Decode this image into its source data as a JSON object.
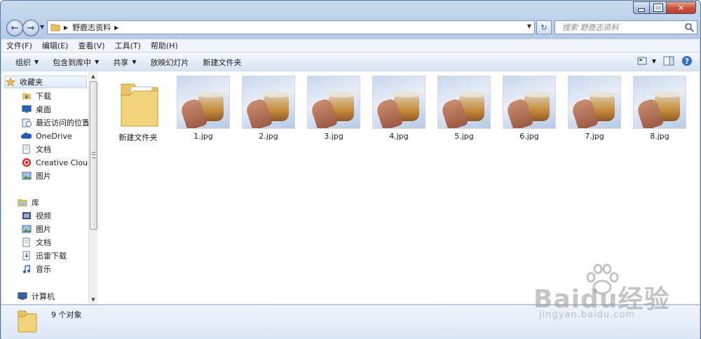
{
  "window": {
    "title_buttons": {
      "minimize": "minimize",
      "maximize": "maximize",
      "close": "close"
    }
  },
  "address": {
    "crumb": "野鹿志资料",
    "separator_icon": "chevron-right-icon"
  },
  "search": {
    "placeholder": "搜索 野鹿志资料"
  },
  "menu": [
    "文件(F)",
    "编辑(E)",
    "查看(V)",
    "工具(T)",
    "帮助(H)"
  ],
  "toolbar": {
    "organize": "组织",
    "include_in_library": "包含到库中",
    "share": "共享",
    "slideshow": "放映幻灯片",
    "new_folder": "新建文件夹"
  },
  "nav": {
    "favorites_label": "收藏夹",
    "favorites": [
      "下载",
      "桌面",
      "最近访问的位置",
      "OneDrive",
      "文档",
      "Creative Cloud",
      "图片"
    ],
    "libraries_label": "库",
    "libraries": [
      "视频",
      "图片",
      "文档",
      "迅雷下载",
      "音乐"
    ],
    "computer_label": "计算机"
  },
  "files": [
    {
      "name": "新建文件夹",
      "type": "folder"
    },
    {
      "name": "1.jpg",
      "type": "image"
    },
    {
      "name": "2.jpg",
      "type": "image"
    },
    {
      "name": "3.jpg",
      "type": "image"
    },
    {
      "name": "4.jpg",
      "type": "image"
    },
    {
      "name": "5.jpg",
      "type": "image"
    },
    {
      "name": "6.jpg",
      "type": "image"
    },
    {
      "name": "7.jpg",
      "type": "image"
    },
    {
      "name": "8.jpg",
      "type": "image"
    }
  ],
  "status": {
    "count": "9 个对象"
  },
  "watermark": {
    "brand": "Baidu经验",
    "url": "jingyan.baidu.com"
  }
}
